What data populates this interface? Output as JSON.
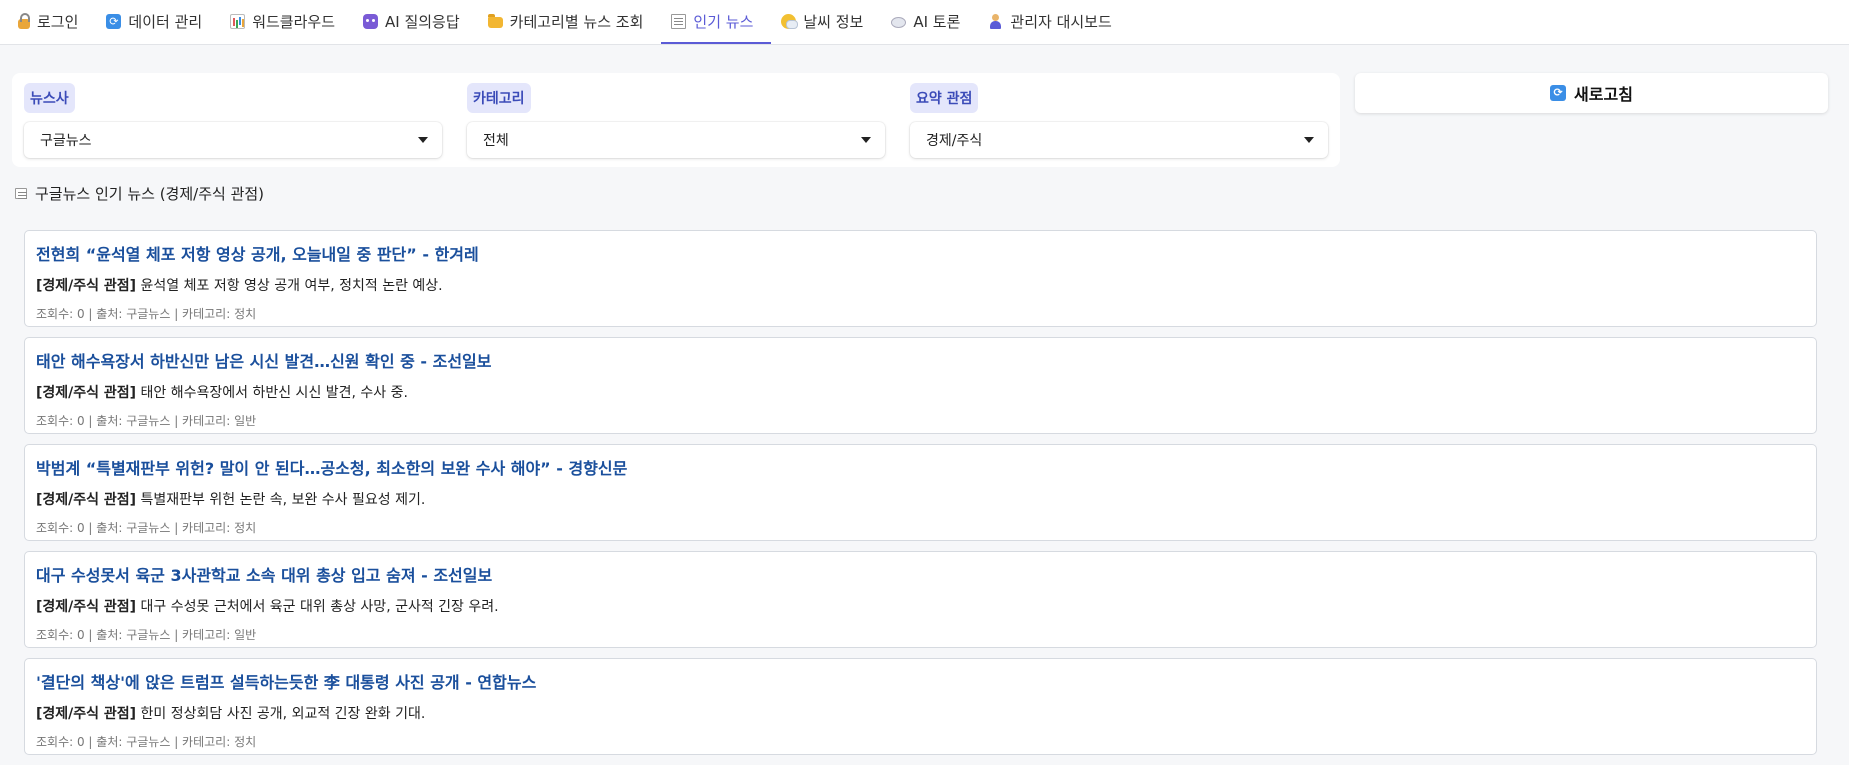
{
  "tabs": [
    {
      "label": "로그인",
      "icon": "lock-icon"
    },
    {
      "label": "데이터 관리",
      "icon": "refresh-icon"
    },
    {
      "label": "워드클라우드",
      "icon": "bar-chart-icon"
    },
    {
      "label": "AI 질의응답",
      "icon": "robot-icon"
    },
    {
      "label": "카테고리별 뉴스 조회",
      "icon": "folder-icon"
    },
    {
      "label": "인기 뉴스",
      "icon": "newspaper-icon",
      "active": true
    },
    {
      "label": "날씨 정보",
      "icon": "weather-icon"
    },
    {
      "label": "AI 토론",
      "icon": "speech-bubble-icon"
    },
    {
      "label": "관리자 대시보드",
      "icon": "admin-person-icon"
    }
  ],
  "filters": {
    "publisher": {
      "label": "뉴스사",
      "value": "구글뉴스"
    },
    "category": {
      "label": "카테고리",
      "value": "전체"
    },
    "perspective": {
      "label": "요약 관점",
      "value": "경제/주식"
    }
  },
  "refresh": {
    "label": "새로고침",
    "icon": "refresh-icon"
  },
  "section": {
    "title": "구글뉴스 인기 뉴스 (경제/주식 관점)",
    "icon": "newspaper-icon"
  },
  "accent_color": "#5b5bd6",
  "news": [
    {
      "title": "전현희 “윤석열 체포 저항 영상 공개, 오늘내일 중 판단” - 한겨레",
      "tag": "[경제/주식 관점]",
      "summary": " 윤석열 체포 저항 영상 공개 여부, 정치적 논란 예상.",
      "meta": "조회수: 0 | 출처: 구글뉴스 | 카테고리: 정치"
    },
    {
      "title": "태안 해수욕장서 하반신만 남은 시신 발견…신원 확인 중 - 조선일보",
      "tag": "[경제/주식 관점]",
      "summary": " 태안 해수욕장에서 하반신 시신 발견, 수사 중.",
      "meta": "조회수: 0 | 출처: 구글뉴스 | 카테고리: 일반"
    },
    {
      "title": "박범계 “특별재판부 위헌? 말이 안 된다…공소청, 최소한의 보완 수사 해야” - 경향신문",
      "tag": "[경제/주식 관점]",
      "summary": " 특별재판부 위헌 논란 속, 보완 수사 필요성 제기.",
      "meta": "조회수: 0 | 출처: 구글뉴스 | 카테고리: 정치"
    },
    {
      "title": "대구 수성못서 육군 3사관학교 소속 대위 총상 입고 숨져 - 조선일보",
      "tag": "[경제/주식 관점]",
      "summary": " 대구 수성못 근처에서 육군 대위 총상 사망, 군사적 긴장 우려.",
      "meta": "조회수: 0 | 출처: 구글뉴스 | 카테고리: 일반"
    },
    {
      "title": "'결단의 책상'에 앉은 트럼프 설득하는듯한 李 대통령 사진 공개 - 연합뉴스",
      "tag": "[경제/주식 관점]",
      "summary": " 한미 정상회담 사진 공개, 외교적 긴장 완화 기대.",
      "meta": "조회수: 0 | 출처: 구글뉴스 | 카테고리: 정치"
    }
  ]
}
